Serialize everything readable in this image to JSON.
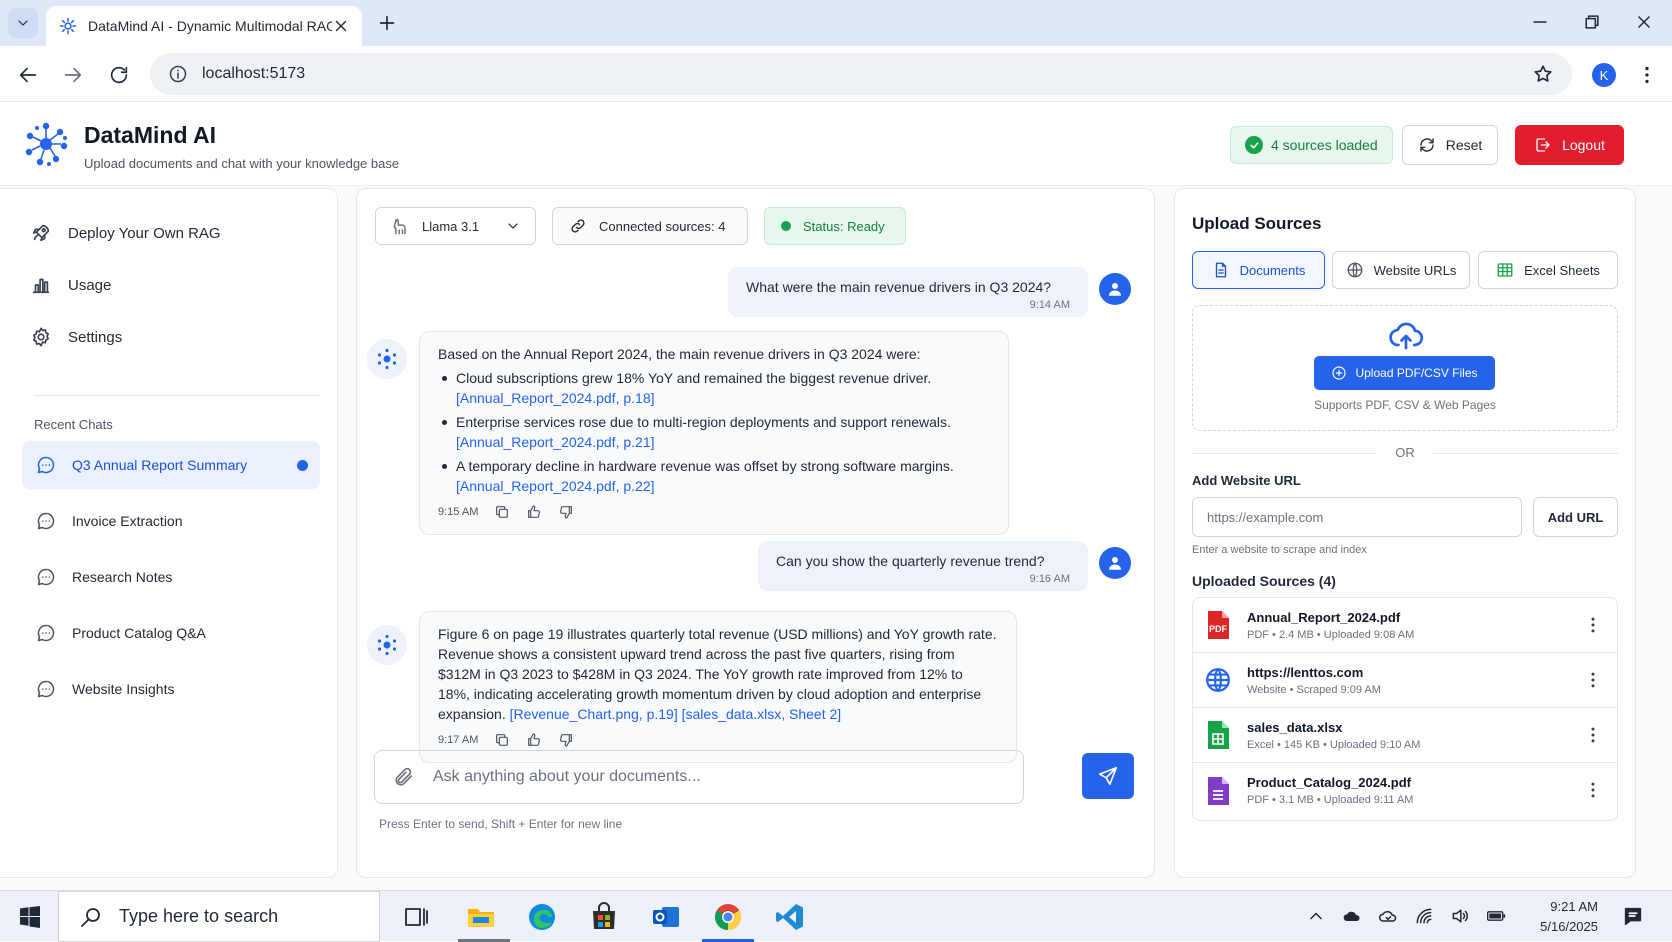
{
  "browser": {
    "tab_title": "DataMind AI - Dynamic Multimodal RAG",
    "url": "localhost:5173",
    "profile_initial": "K"
  },
  "header": {
    "brand": "DataMind AI",
    "tagline": "Upload documents and chat with your knowledge base",
    "sources_badge": "4 sources loaded",
    "reset_label": "Reset",
    "logout_label": "Logout"
  },
  "sidebar": {
    "nav": [
      {
        "label": "Deploy Your Own RAG",
        "icon": "rocket-icon"
      },
      {
        "label": "Usage",
        "icon": "bar-chart-icon"
      },
      {
        "label": "Settings",
        "icon": "gear-icon"
      }
    ],
    "recent_heading": "Recent Chats",
    "chats": [
      {
        "label": "Q3 Annual Report Summary",
        "active": true
      },
      {
        "label": "Invoice Extraction"
      },
      {
        "label": "Research Notes"
      },
      {
        "label": "Product Catalog Q&A"
      },
      {
        "label": "Website Insights"
      }
    ]
  },
  "chat": {
    "model": "Llama 3.1",
    "connected": "Connected sources: 4",
    "status": "Status: Ready",
    "messages": [
      {
        "role": "user",
        "text": "What were the main revenue drivers in Q3 2024?",
        "time": "9:14 AM"
      },
      {
        "role": "assistant",
        "intro": "Based on the Annual Report 2024, the main revenue drivers in Q3 2024 were:",
        "bullets": [
          {
            "text": "Cloud subscriptions grew 18% YoY and remained the biggest revenue driver.",
            "cite": "[Annual_Report_2024.pdf, p.18]"
          },
          {
            "text": "Enterprise services rose due to multi-region deployments and support renewals.",
            "cite": "[Annual_Report_2024.pdf, p.21]"
          },
          {
            "text": "A temporary decline in hardware revenue was offset by strong software margins.",
            "cite": "[Annual_Report_2024.pdf, p.22]"
          }
        ],
        "time": "9:15 AM"
      },
      {
        "role": "user",
        "text": "Can you show the quarterly revenue trend?",
        "time": "9:16 AM"
      },
      {
        "role": "assistant",
        "text": "Figure 6 on page 19 illustrates quarterly total revenue (USD millions) and YoY growth rate. Revenue shows a consistent upward trend across the past five quarters, rising from $312M in Q3 2023 to $428M in Q3 2024. The YoY growth rate improved from 12% to 18%, indicating accelerating growth momentum driven by cloud adoption and enterprise expansion.",
        "cite1": "[Revenue_Chart.png, p.19]",
        "cite2": "[sales_data.xlsx, Sheet 2]",
        "time": "9:17 AM"
      }
    ],
    "input_placeholder": "Ask anything about your documents...",
    "hint": "Press Enter to send, Shift + Enter for new line"
  },
  "upload": {
    "title": "Upload Sources",
    "tabs": [
      "Documents",
      "Website URLs",
      "Excel Sheets"
    ],
    "upload_button": "Upload PDF/CSV Files",
    "supports": "Supports PDF, CSV & Web Pages",
    "or": "OR",
    "add_heading": "Add Website URL",
    "url_placeholder": "https://example.com",
    "add_button": "Add URL",
    "url_note": "Enter a website to scrape and index",
    "sources_heading": "Uploaded Sources (4)",
    "sources": [
      {
        "name": "Annual_Report_2024.pdf",
        "meta": "PDF • 2.4 MB • Uploaded 9:08 AM",
        "icon": "pdf-file-icon"
      },
      {
        "name": "https://lenttos.com",
        "meta": "Website • Scraped 9:09 AM",
        "icon": "globe-icon"
      },
      {
        "name": "sales_data.xlsx",
        "meta": "Excel • 145 KB • Uploaded 9:10 AM",
        "icon": "excel-file-icon"
      },
      {
        "name": "Product_Catalog_2024.pdf",
        "meta": "PDF • 3.1 MB • Uploaded 9:11 AM",
        "icon": "catalog-file-icon"
      }
    ]
  },
  "taskbar": {
    "search_placeholder": "Type here to search",
    "time": "9:21 AM",
    "date": "5/16/2025"
  },
  "colors": {
    "accent": "#2563eb",
    "danger": "#e11d2e",
    "success": "#16a34a"
  }
}
